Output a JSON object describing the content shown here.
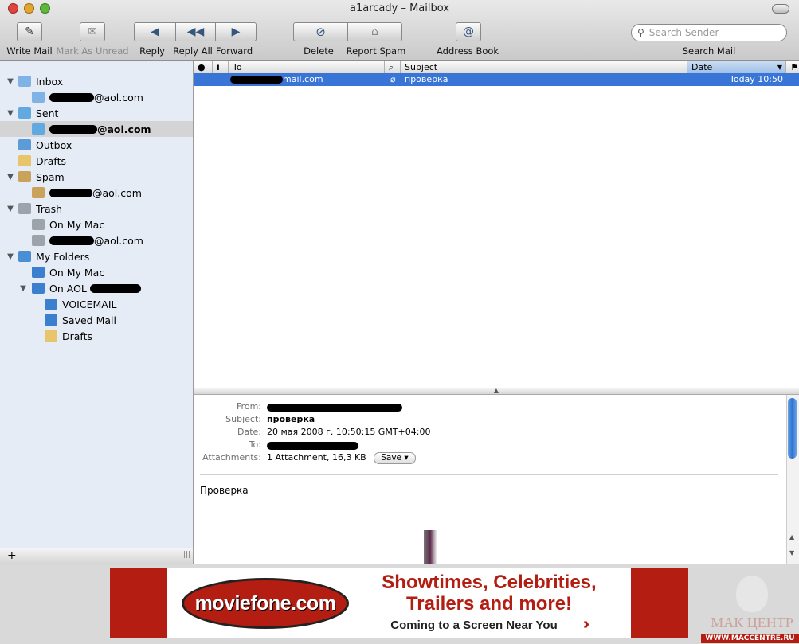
{
  "window": {
    "title": "a1arcady – Mailbox"
  },
  "toolbar": {
    "write_mail": "Write Mail",
    "mark_as_unread": "Mark As Unread",
    "reply": "Reply",
    "reply_all": "Reply All",
    "forward": "Forward",
    "delete": "Delete",
    "report_spam": "Report Spam",
    "address_book": "Address Book",
    "search_placeholder": "Search Sender",
    "search_label": "Search Mail"
  },
  "sidebar": {
    "inbox": "Inbox",
    "inbox_account": "@aol.com",
    "sent": "Sent",
    "sent_account": "@aol.com",
    "outbox": "Outbox",
    "drafts": "Drafts",
    "spam": "Spam",
    "spam_account": "@aol.com",
    "trash": "Trash",
    "trash_on_my_mac": "On My Mac",
    "trash_account": "@aol.com",
    "my_folders": "My Folders",
    "folders_on_my_mac": "On My Mac",
    "on_aol": "On AOL",
    "voicemail": "VOICEMAIL",
    "saved_mail": "Saved Mail",
    "aol_drafts": "Drafts",
    "add_button": "+"
  },
  "list": {
    "columns": {
      "to": "To",
      "subject": "Subject",
      "date": "Date"
    },
    "messages": [
      {
        "to_suffix": "mail.com",
        "subject": "проверка",
        "date": "Today 10:50"
      }
    ]
  },
  "preview": {
    "labels": {
      "from": "From:",
      "subject": "Subject:",
      "date": "Date:",
      "to": "To:",
      "attachments": "Attachments:"
    },
    "subject": "проверка",
    "date": "20 мая 2008 г. 10:50:15 GMT+04:00",
    "attachments": "1 Attachment, 16,3 KB",
    "save_label": "Save",
    "body": "Проверка"
  },
  "banner": {
    "logo": "moviefone.com",
    "line1": "Showtimes, Celebrities,",
    "line2": "Trailers and more!",
    "line3": "Coming to a Screen Near You",
    "watermark": "МАК ЦЕНТР",
    "watermark_url": "WWW.MACCENTRE.RU"
  },
  "colors": {
    "selection": "#3875d7",
    "sidebar_bg": "#e6ecf5",
    "ad_red": "#b31d12"
  }
}
